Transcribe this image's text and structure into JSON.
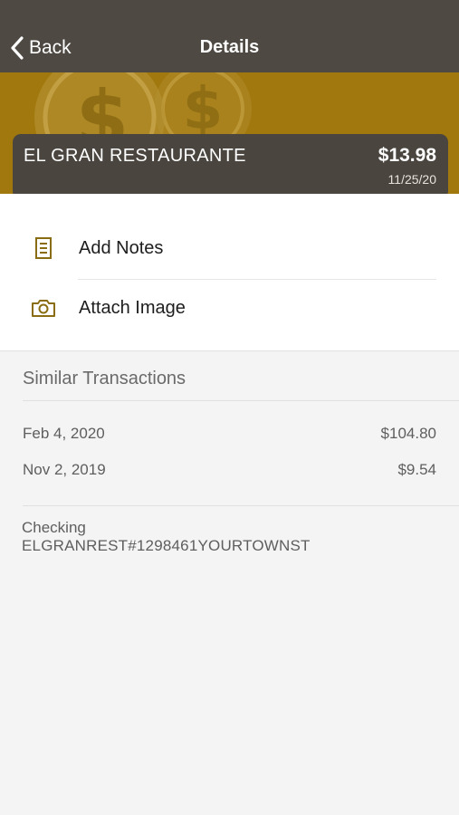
{
  "nav": {
    "back_label": "Back",
    "title": "Details"
  },
  "transaction": {
    "merchant": "EL GRAN RESTAURANTE",
    "amount": "$13.98",
    "date": "11/25/20"
  },
  "actions": [
    {
      "label": "Add Notes",
      "icon": "notes-icon"
    },
    {
      "label": "Attach Image",
      "icon": "camera-icon"
    }
  ],
  "similar": {
    "header": "Similar Transactions",
    "rows": [
      {
        "date": "Feb 4, 2020",
        "amount": "$104.80"
      },
      {
        "date": "Nov 2, 2019",
        "amount": "$9.54"
      }
    ]
  },
  "account": {
    "type": "Checking",
    "description": "ELGRANREST#1298461YOURTOWNST"
  },
  "colors": {
    "nav_bg": "#4e4942",
    "banner_gold": "#a0780e",
    "card_bg": "#4a463f",
    "icon_gold": "#8a6d12"
  }
}
